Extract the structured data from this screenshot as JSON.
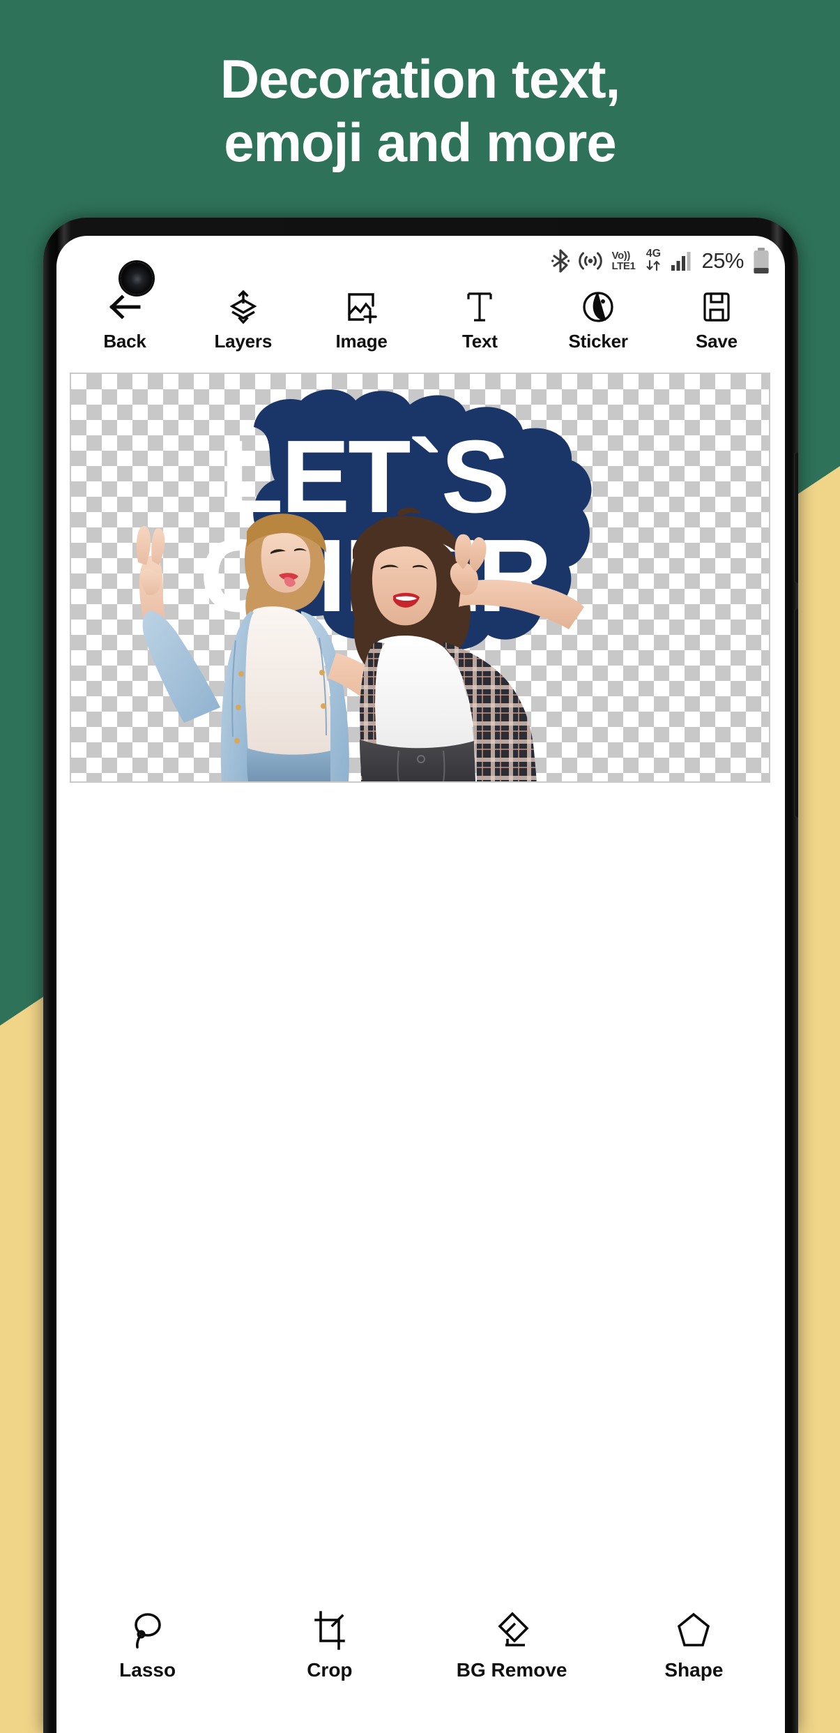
{
  "promo": {
    "headline_line1": "Decoration text,",
    "headline_line2": "emoji and more",
    "bg_color": "#2e7259",
    "accent_band_color": "#f0d488",
    "headline_color": "#ffffff"
  },
  "status_bar": {
    "bluetooth_icon": "bluetooth-icon",
    "hotspot_icon": "hotspot-icon",
    "volte_label_top": "Vo))",
    "volte_label_bottom": "LTE1",
    "network_label": "4G",
    "data_arrows": "data-transfer-icon",
    "signal_icon": "signal-bars-icon",
    "battery_percent": "25%",
    "battery_icon": "battery-icon"
  },
  "toolbar_top": {
    "items": [
      {
        "label": "Back",
        "icon": "arrow-left-icon"
      },
      {
        "label": "Layers",
        "icon": "layers-icon"
      },
      {
        "label": "Image",
        "icon": "image-add-icon"
      },
      {
        "label": "Text",
        "icon": "text-t-icon"
      },
      {
        "label": "Sticker",
        "icon": "sticker-icon"
      },
      {
        "label": "Save",
        "icon": "floppy-save-icon"
      }
    ]
  },
  "canvas": {
    "transparency_checker_light": "#ffffff",
    "transparency_checker_dark": "#c8c8c8",
    "sticker": {
      "shape": "blob-sticker",
      "fill_color": "#1a3568",
      "text_line1": "LET`S",
      "text_line2": "CHEER",
      "text_color": "#ffffff"
    },
    "photo": {
      "description": "two-young-women-cheering-cutout",
      "subjects": [
        {
          "name": "woman-left",
          "outfit": "denim-jacket-white-tee-jeans",
          "hair": "blonde-wavy",
          "pose": "arm-raised-peace-sign-tongue-out"
        },
        {
          "name": "woman-right",
          "outfit": "plaid-shirt-white-tee-dark-jeans",
          "hair": "brunette-curly",
          "pose": "peace-sign-near-face-mouth-open"
        }
      ]
    }
  },
  "toolbar_bottom": {
    "items": [
      {
        "label": "Lasso",
        "icon": "lasso-icon"
      },
      {
        "label": "Crop",
        "icon": "crop-icon"
      },
      {
        "label": "BG Remove",
        "icon": "eraser-icon"
      },
      {
        "label": "Shape",
        "icon": "pentagon-shape-icon"
      }
    ]
  }
}
